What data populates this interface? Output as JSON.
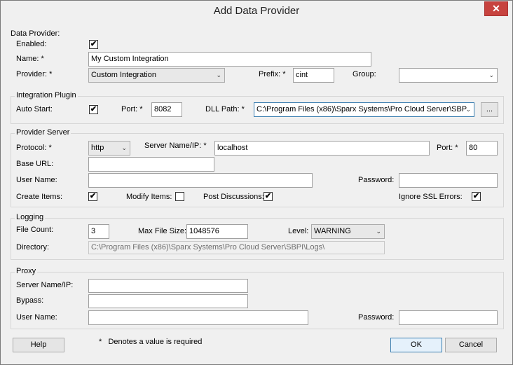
{
  "window": {
    "title": "Add Data Provider",
    "close_glyph": "✕"
  },
  "data_provider": {
    "section_label": "Data Provider:",
    "enabled_label": "Enabled:",
    "enabled": true,
    "name_label": "Name:",
    "name_value": "My Custom Integration",
    "provider_label": "Provider:",
    "provider_value": "Custom Integration",
    "prefix_label": "Prefix:",
    "prefix_value": "cint",
    "group_label": "Group:",
    "group_value": "",
    "required_mark": "*"
  },
  "integration_plugin": {
    "title": "Integration Plugin",
    "auto_start_label": "Auto Start:",
    "auto_start": true,
    "port_label": "Port:",
    "port_value": "8082",
    "dll_path_label": "DLL Path:",
    "dll_path_value": "C:\\Program Files (x86)\\Sparx Systems\\Pro Cloud Server\\SBP",
    "browse_label": "..."
  },
  "provider_server": {
    "title": "Provider Server",
    "protocol_label": "Protocol:",
    "protocol_value": "http",
    "server_label": "Server Name/IP:",
    "server_value": "localhost",
    "port_label": "Port:",
    "port_value": "80",
    "base_url_label": "Base URL:",
    "base_url_value": "",
    "user_name_label": "User Name:",
    "user_name_value": "",
    "password_label": "Password:",
    "password_value": "",
    "create_items_label": "Create Items:",
    "create_items": true,
    "modify_items_label": "Modify Items:",
    "modify_items": false,
    "post_discussions_label": "Post Discussions:",
    "post_discussions": true,
    "ignore_ssl_label": "Ignore SSL Errors:",
    "ignore_ssl": true
  },
  "logging": {
    "title": "Logging",
    "file_count_label": "File Count:",
    "file_count_value": "3",
    "max_file_size_label": "Max File Size:",
    "max_file_size_value": "1048576",
    "level_label": "Level:",
    "level_value": "WARNING",
    "directory_label": "Directory:",
    "directory_value": "C:\\Program Files (x86)\\Sparx Systems\\Pro Cloud Server\\SBPI\\Logs\\"
  },
  "proxy": {
    "title": "Proxy",
    "server_label": "Server Name/IP:",
    "server_value": "",
    "bypass_label": "Bypass:",
    "bypass_value": "",
    "user_name_label": "User Name:",
    "user_name_value": "",
    "password_label": "Password:",
    "password_value": ""
  },
  "footer": {
    "help_label": "Help",
    "note_star": "*",
    "note_text": "Denotes a value is required",
    "ok_label": "OK",
    "cancel_label": "Cancel"
  },
  "check_glyph": "✔",
  "arrow_glyph": "⌄"
}
